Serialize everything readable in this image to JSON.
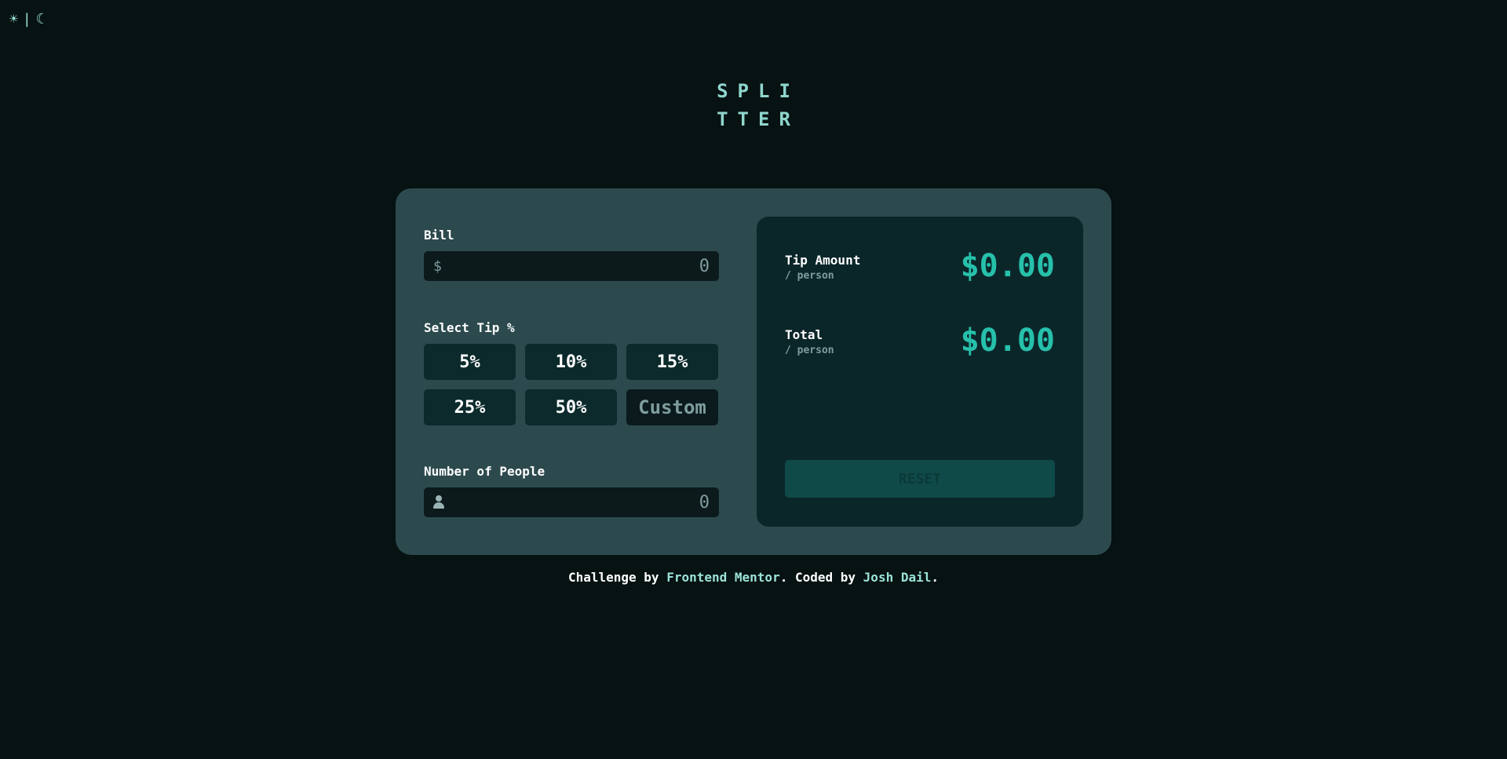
{
  "theme_toggle": {
    "light_icon": "☀",
    "separator": "|",
    "dark_icon": "☾"
  },
  "logo": {
    "line1": "SPLI",
    "line2": "TTER"
  },
  "bill": {
    "label": "Bill",
    "prefix": "$",
    "value": "0"
  },
  "tip": {
    "label": "Select Tip %",
    "options": [
      "5%",
      "10%",
      "15%",
      "25%",
      "50%"
    ],
    "custom_placeholder": "Custom"
  },
  "people": {
    "label": "Number of People",
    "value": "0"
  },
  "results": {
    "tip_title": "Tip Amount",
    "tip_sub": "/ person",
    "tip_amount": "$0.00",
    "total_title": "Total",
    "total_sub": "/ person",
    "total_amount": "$0.00",
    "reset_label": "RESET"
  },
  "footer": {
    "prefix": "Challenge by ",
    "link1": "Frontend Mentor",
    "middle": ". Coded by ",
    "link2": "Josh Dail",
    "suffix": "."
  },
  "colors": {
    "background": "#071212",
    "card": "#2c4a4e",
    "panel": "#0b2629",
    "accent": "#26c0ab"
  }
}
